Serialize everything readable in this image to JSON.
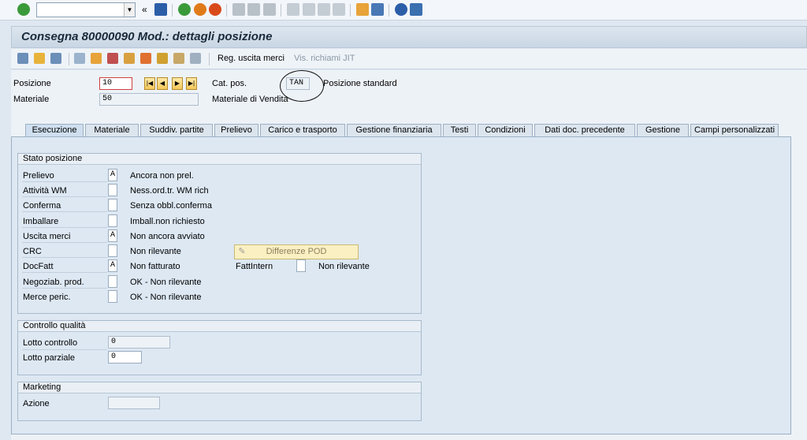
{
  "system_toolbar": {
    "command_value": "",
    "colors": {
      "ok": "#3a9a3a",
      "back": "#e07b1a",
      "exit": "#d94a1a",
      "cancel": "#c0392b",
      "save": "#2c5ea8",
      "help": "#2c5ea8"
    }
  },
  "title": "Consegna 80000090 Mod.: dettagli posizione",
  "app_toolbar": {
    "goods_issue_label": "Reg. uscita merci",
    "jit_label": "Vis. richiami JIT"
  },
  "header": {
    "item_label": "Posizione",
    "item_value": "10",
    "material_label": "Materiale",
    "material_value": "50",
    "item_cat_label": "Cat. pos.",
    "item_cat_value": "TAN",
    "item_cat_desc": "Posizione standard",
    "material_desc": "Materiale di Vendita"
  },
  "tabs": [
    {
      "label": "Esecuzione",
      "active": true
    },
    {
      "label": "Materiale"
    },
    {
      "label": "Suddiv. partite"
    },
    {
      "label": "Prelievo"
    },
    {
      "label": "Carico e trasporto"
    },
    {
      "label": "Gestione finanziaria"
    },
    {
      "label": "Testi"
    },
    {
      "label": "Condizioni"
    },
    {
      "label": "Dati doc. precedente"
    },
    {
      "label": "Gestione"
    },
    {
      "label": "Campi personalizzati"
    }
  ],
  "status_group": {
    "title": "Stato posizione",
    "rows": [
      {
        "label": "Prelievo",
        "code": "A",
        "text": "Ancora non prel."
      },
      {
        "label": "Attività WM",
        "code": "",
        "text": "Ness.ord.tr. WM rich"
      },
      {
        "label": "Conferma",
        "code": "",
        "text": "Senza obbl.conferma"
      },
      {
        "label": "Imballare",
        "code": "",
        "text": "Imball.non richiesto"
      },
      {
        "label": "Uscita merci",
        "code": "A",
        "text": "Non ancora avviato"
      },
      {
        "label": "CRC",
        "code": "",
        "text": "Non rilevante"
      },
      {
        "label": "DocFatt",
        "code": "A",
        "text": "Non fatturato"
      },
      {
        "label": "Negoziab. prod.",
        "code": "",
        "text": "OK - Non rilevante"
      },
      {
        "label": "Merce peric.",
        "code": "",
        "text": "OK - Non rilevante"
      }
    ],
    "pod_button": "Differenze POD",
    "intern_label": "FattIntern",
    "intern_code": "",
    "intern_text": "Non rilevante"
  },
  "qc_group": {
    "title": "Controllo qualità",
    "lot_label": "Lotto controllo",
    "lot_value": "0",
    "partial_label": "Lotto parziale",
    "partial_value": "0"
  },
  "marketing_group": {
    "title": "Marketing",
    "action_label": "Azione",
    "action_value": ""
  }
}
